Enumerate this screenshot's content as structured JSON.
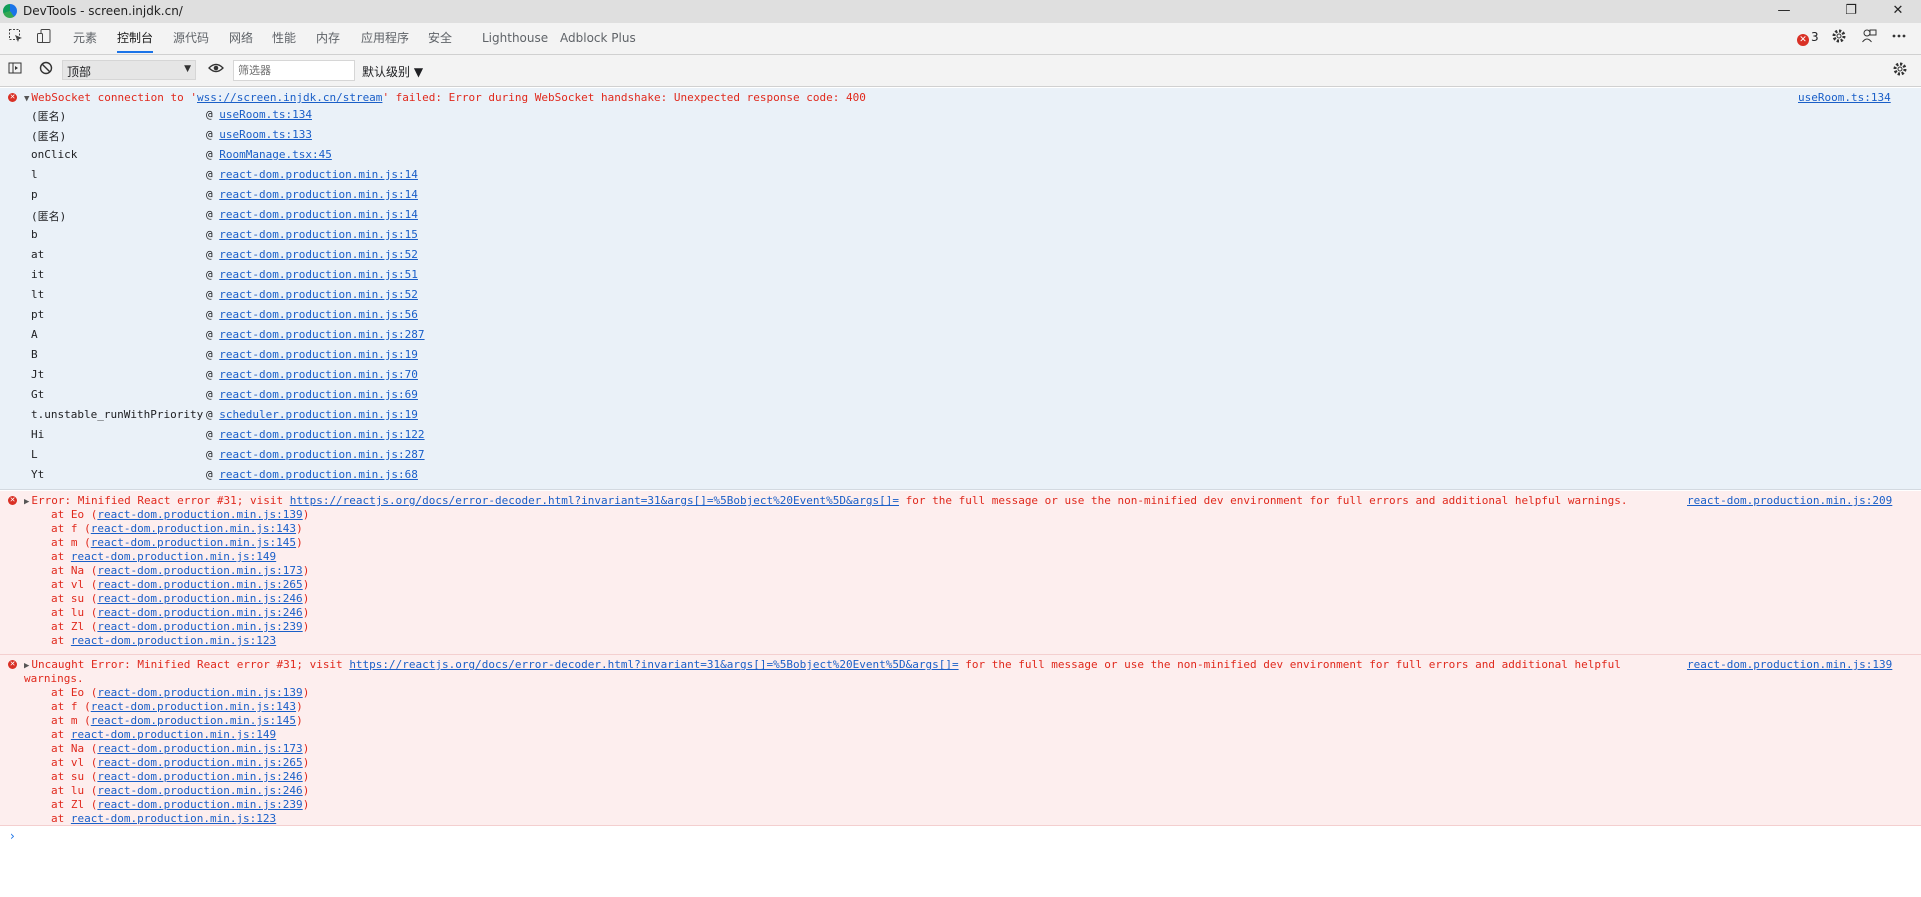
{
  "window": {
    "title": "DevTools - screen.injdk.cn/",
    "minimize": "—",
    "restore": "❐",
    "close": "✕"
  },
  "tabs": [
    {
      "label": "元素"
    },
    {
      "label": "控制台"
    },
    {
      "label": "源代码"
    },
    {
      "label": "网络"
    },
    {
      "label": "性能"
    },
    {
      "label": "内存"
    },
    {
      "label": "应用程序"
    },
    {
      "label": "安全"
    },
    {
      "label": "Lighthouse"
    },
    {
      "label": "Adblock Plus"
    }
  ],
  "active_tab": "控制台",
  "issues": {
    "error_count": "3"
  },
  "console_toolbar": {
    "context": "顶部",
    "filter_placeholder": "筛选器",
    "levels": "默认级别 ▼"
  },
  "messages": {
    "ws": {
      "prefix": "WebSocket connection to '",
      "url": "wss://screen.injdk.cn/stream",
      "suffix": "' failed: Error during WebSocket handshake: Unexpected response code: 400",
      "source": "useRoom.ts:134",
      "frames": [
        {
          "name": "(匿名)",
          "link": "useRoom.ts:134"
        },
        {
          "name": "(匿名)",
          "link": "useRoom.ts:133"
        },
        {
          "name": "onClick",
          "link": "RoomManage.tsx:45"
        },
        {
          "name": "l",
          "link": "react-dom.production.min.js:14"
        },
        {
          "name": "p",
          "link": "react-dom.production.min.js:14"
        },
        {
          "name": "(匿名)",
          "link": "react-dom.production.min.js:14"
        },
        {
          "name": "b",
          "link": "react-dom.production.min.js:15"
        },
        {
          "name": "at",
          "link": "react-dom.production.min.js:52"
        },
        {
          "name": "it",
          "link": "react-dom.production.min.js:51"
        },
        {
          "name": "lt",
          "link": "react-dom.production.min.js:52"
        },
        {
          "name": "pt",
          "link": "react-dom.production.min.js:56"
        },
        {
          "name": "A",
          "link": "react-dom.production.min.js:287"
        },
        {
          "name": "B",
          "link": "react-dom.production.min.js:19"
        },
        {
          "name": "Jt",
          "link": "react-dom.production.min.js:70"
        },
        {
          "name": "Gt",
          "link": "react-dom.production.min.js:69"
        },
        {
          "name": "t.unstable_runWithPriority",
          "link": "scheduler.production.min.js:19"
        },
        {
          "name": "Hi",
          "link": "react-dom.production.min.js:122"
        },
        {
          "name": "L",
          "link": "react-dom.production.min.js:287"
        },
        {
          "name": "Yt",
          "link": "react-dom.production.min.js:68"
        }
      ]
    },
    "err1": {
      "prefix": "Error: Minified React error #31; visit ",
      "url": "https://reactjs.org/docs/error-decoder.html?invariant=31&args[]=%5Bobject%20Event%5D&args[]=",
      "suffix": " for the full message or use the non-minified dev environment for full errors and additional helpful warnings.",
      "source": "react-dom.production.min.js:209",
      "stack": [
        {
          "fn": "Eo",
          "link": "react-dom.production.min.js:139"
        },
        {
          "fn": "f",
          "link": "react-dom.production.min.js:143"
        },
        {
          "fn": "m",
          "link": "react-dom.production.min.js:145"
        },
        {
          "fn": "",
          "link": "react-dom.production.min.js:149"
        },
        {
          "fn": "Na",
          "link": "react-dom.production.min.js:173"
        },
        {
          "fn": "vl",
          "link": "react-dom.production.min.js:265"
        },
        {
          "fn": "su",
          "link": "react-dom.production.min.js:246"
        },
        {
          "fn": "lu",
          "link": "react-dom.production.min.js:246"
        },
        {
          "fn": "Zl",
          "link": "react-dom.production.min.js:239"
        },
        {
          "fn": "",
          "link": "react-dom.production.min.js:123"
        }
      ]
    },
    "err2": {
      "prefix": "Uncaught Error: Minified React error #31; visit ",
      "url": "https://reactjs.org/docs/error-decoder.html?invariant=31&args[]=%5Bobject%20Event%5D&args[]=",
      "suffix": " for the full message or use the non-minified dev environment for full errors and additional helpful",
      "line2": "warnings.",
      "source": "react-dom.production.min.js:139",
      "stack": [
        {
          "fn": "Eo",
          "link": "react-dom.production.min.js:139"
        },
        {
          "fn": "f",
          "link": "react-dom.production.min.js:143"
        },
        {
          "fn": "m",
          "link": "react-dom.production.min.js:145"
        },
        {
          "fn": "",
          "link": "react-dom.production.min.js:149"
        },
        {
          "fn": "Na",
          "link": "react-dom.production.min.js:173"
        },
        {
          "fn": "vl",
          "link": "react-dom.production.min.js:265"
        },
        {
          "fn": "su",
          "link": "react-dom.production.min.js:246"
        },
        {
          "fn": "lu",
          "link": "react-dom.production.min.js:246"
        },
        {
          "fn": "Zl",
          "link": "react-dom.production.min.js:239"
        },
        {
          "fn": "",
          "link": "react-dom.production.min.js:123"
        }
      ]
    }
  },
  "prompt": "›"
}
